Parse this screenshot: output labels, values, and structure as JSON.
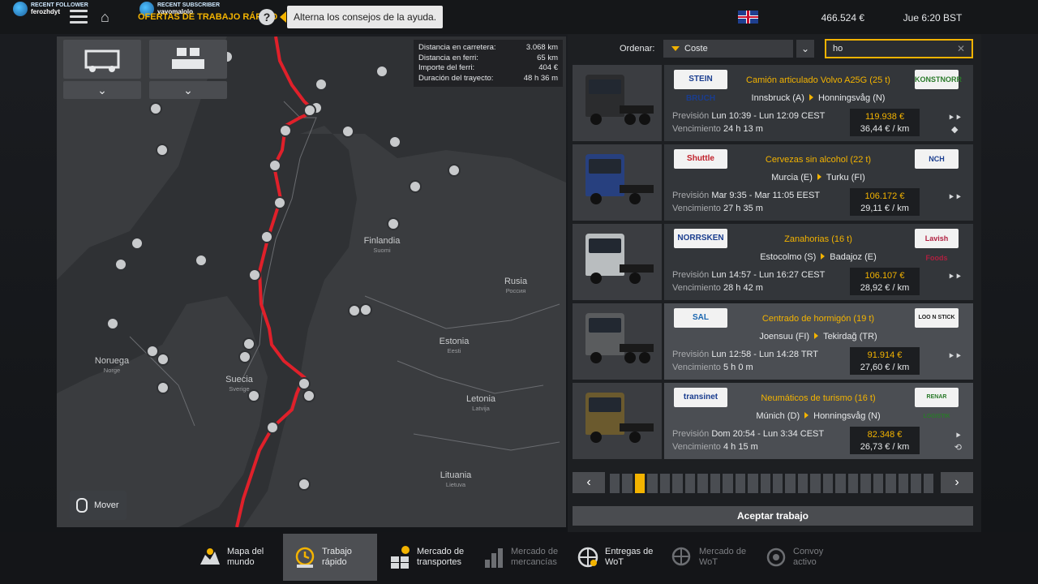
{
  "stream": {
    "follower_label": "RECENT FOLLOWER",
    "follower_name": "ferozhdyt",
    "subscriber_label": "RECENT SUBSCRIBER",
    "subscriber_name": "yayomalolo"
  },
  "header": {
    "breadcrumb": "OFERTAS DE TRABAJO RÁPIDO",
    "help_tooltip": "Alterna los consejos de la ayuda.",
    "money": "466.524 €",
    "datetime": "Jue 6:20 BST",
    "language_flag": "uk-flag-icon"
  },
  "map": {
    "stats": [
      {
        "label": "Distancia en carretera:",
        "value": "3.068 km"
      },
      {
        "label": "Distancia en ferri:",
        "value": "65 km"
      },
      {
        "label": "Importe del ferri:",
        "value": "404 €"
      },
      {
        "label": "Duración del trayecto:",
        "value": "48 h 36 m"
      }
    ],
    "labels": [
      {
        "name": "Finlandia",
        "sub": "Suomi"
      },
      {
        "name": "Rusia",
        "sub": "Россия"
      },
      {
        "name": "Estonia",
        "sub": "Eesti"
      },
      {
        "name": "Noruega",
        "sub": "Norge"
      },
      {
        "name": "Suecia",
        "sub": "Sverige"
      },
      {
        "name": "Letonia",
        "sub": "Latvija"
      },
      {
        "name": "Lituania",
        "sub": "Lietuva"
      }
    ],
    "mover_label": "Mover",
    "route_color": "#e0202a"
  },
  "offers": {
    "sort_label": "Ordenar:",
    "sort_value": "Coste",
    "search_value": "ho",
    "accept_label": "Aceptar trabajo",
    "jobs": [
      {
        "logo_left": "STEIN BRUCH",
        "logo_right": "KONSTNORR",
        "cargo": "Camión articulado Volvo A25G (25 t)",
        "from": "Innsbruck (A)",
        "to": "Honningsvåg (N)",
        "forecast_label": "Previsión",
        "forecast": "Lun 10:39 - Lun 12:09 CEST",
        "expiry_label": "Vencimiento",
        "expiry": "24 h 13 m",
        "price": "119.938 €",
        "per_km": "36,44 € / km",
        "truck_color": "#2b2c2e"
      },
      {
        "logo_left": "Shuttle",
        "logo_right": "NCH",
        "cargo": "Cervezas sin alcohol (22 t)",
        "from": "Murcia (E)",
        "to": "Turku (FI)",
        "forecast_label": "Previsión",
        "forecast": "Mar 9:35 - Mar 11:05 EEST",
        "expiry_label": "Vencimiento",
        "expiry": "27 h 35 m",
        "price": "106.172 €",
        "per_km": "29,11 € / km",
        "truck_color": "#27407f"
      },
      {
        "logo_left": "NORRSKEN",
        "logo_right": "Lavish Foods",
        "cargo": "Zanahorias (16 t)",
        "from": "Estocolmo (S)",
        "to": "Badajoz (E)",
        "forecast_label": "Previsión",
        "forecast": "Lun 14:57 - Lun 16:27 CEST",
        "expiry_label": "Vencimiento",
        "expiry": "28 h 42 m",
        "price": "106.107 €",
        "per_km": "28,92 € / km",
        "truck_color": "#b9bdbf"
      },
      {
        "logo_left": "SAL",
        "logo_right": "LOO N STICK",
        "cargo": "Centrado de hormigón (19 t)",
        "from": "Joensuu (FI)",
        "to": "Tekirdağ (TR)",
        "forecast_label": "Previsión",
        "forecast": "Lun 12:58 - Lun 14:28 TRT",
        "expiry_label": "Vencimiento",
        "expiry": "5 h 0 m",
        "price": "91.914 €",
        "per_km": "27,60 € / km",
        "truck_color": "#5a5c5e"
      },
      {
        "logo_left": "transinet",
        "logo_right": "RENAR LOGISTIK",
        "cargo": "Neumáticos de turismo (16 t)",
        "from": "Múnich (D)",
        "to": "Honningsvåg (N)",
        "forecast_label": "Previsión",
        "forecast": "Dom 20:54 - Lun 3:34 CEST",
        "expiry_label": "Vencimiento",
        "expiry": "4 h 15 m",
        "price": "82.348 €",
        "per_km": "26,73 € / km",
        "truck_color": "#6b5a2e"
      }
    ],
    "pager_selected_index": 2,
    "pager_segments": 26
  },
  "nav": [
    {
      "label1": "Mapa del",
      "label2": "mundo",
      "icon": "world-map-icon"
    },
    {
      "label1": "Trabajo",
      "label2": "rápido",
      "icon": "quick-job-clock-icon"
    },
    {
      "label1": "Mercado de",
      "label2": "transportes",
      "icon": "freight-market-icon"
    },
    {
      "label1": "Mercado de",
      "label2": "mercancías",
      "icon": "cargo-market-icon"
    },
    {
      "label1": "Entregas de",
      "label2": "WoT",
      "icon": "wot-deliveries-icon"
    },
    {
      "label1": "Mercado de",
      "label2": "WoT",
      "icon": "wot-market-icon"
    },
    {
      "label1": "Convoy",
      "label2": "activo",
      "icon": "convoy-icon"
    }
  ],
  "colors": {
    "accent": "#f3b300",
    "panel": "#33363a",
    "selected": "#4b4e53"
  }
}
